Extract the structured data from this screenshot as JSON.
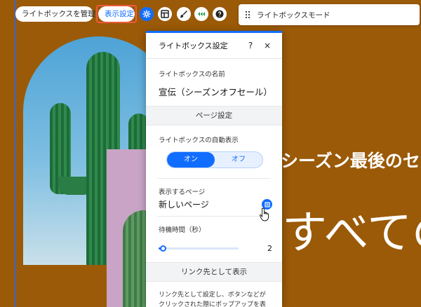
{
  "toolbar": {
    "manage_label": "ライトボックスを管理",
    "display_settings_label": "表示設定",
    "icons": [
      "gear-icon",
      "layout-icon",
      "design-brush-icon",
      "animation-icon",
      "help-icon"
    ]
  },
  "mode_bar": {
    "label": "ライトボックスモード"
  },
  "canvas": {
    "heading_small": "シーズン最後のセール",
    "heading_big": "すべてのアイテム",
    "background_color": "#9b5a07"
  },
  "panel": {
    "title": "ライトボックス設定",
    "help": "?",
    "close": "×",
    "name_label": "ライトボックスの名前",
    "name_value": "宣伝（シーズンオフセール）",
    "page_settings_header": "ページ設定",
    "auto_display_label": "ライトボックスの自動表示",
    "toggle_on": "オン",
    "toggle_off": "オフ",
    "toggle_selected": "オン",
    "display_page_label": "表示するページ",
    "display_page_value": "新しいページ",
    "wait_time_label": "待機時間（秒）",
    "wait_time_value": "2",
    "wait_time_fraction": 0.05,
    "link_header": "リンク先として表示",
    "link_desc": "リンク先として設定し、ボタンなどがクリックされた際にポップアップを表",
    "accent_color": "#116dff"
  }
}
